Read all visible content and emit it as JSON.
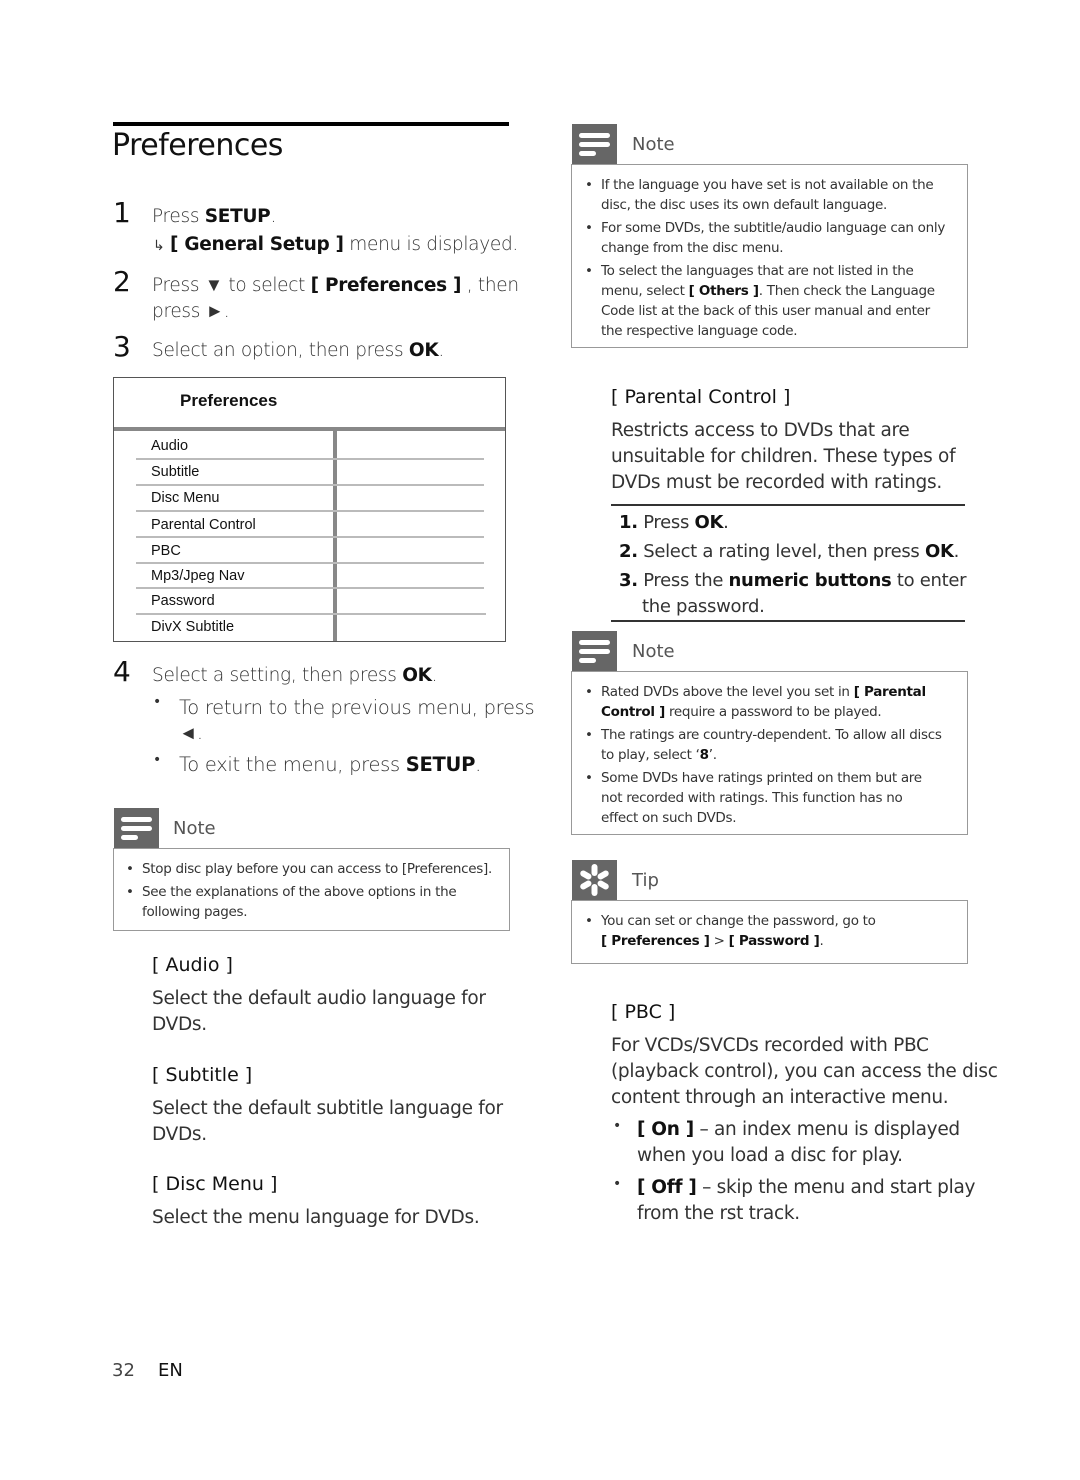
{
  "page": {
    "title": "Preferences",
    "page_number": "32",
    "language": "EN"
  },
  "steps": [
    {
      "num": "1",
      "line1_pre": "Press ",
      "line1_bold": "SETUP",
      "line1_post": ".",
      "sub_arrow": "↳",
      "sub_bold": "[ General Setup ]",
      "sub_post": " menu is displayed."
    },
    {
      "num": "2",
      "pre": "Press ▼ to select ",
      "bold": "[ Preferences ]",
      "post": " , then",
      "line2": "press ►."
    },
    {
      "num": "3",
      "pre": "Select an option, then press ",
      "bold": "OK",
      "post": "."
    },
    {
      "num": "4",
      "pre": "Select a setting, then press ",
      "bold": "OK",
      "post": "."
    }
  ],
  "step4_bullets": [
    {
      "text": "To return to the previous menu, press",
      "line2": "◄."
    },
    {
      "pre": "To exit the menu, press ",
      "bold": "SETUP",
      "post": "."
    }
  ],
  "menu": {
    "title": "Preferences",
    "items": [
      "Audio",
      "Subtitle",
      "Disc Menu",
      "Parental Control",
      "PBC",
      "Mp3/Jpeg Nav",
      "Password",
      "DivX Subtitle"
    ]
  },
  "note_left": {
    "label": "Note",
    "items": [
      "Stop disc play before you can access to [Preferences].",
      "See the explanations of the above options in the",
      "following pages."
    ]
  },
  "sections_left": [
    {
      "head": "[ Audio ]",
      "lines": [
        "Select the default audio language for",
        "DVDs."
      ]
    },
    {
      "head": "[ Subtitle ]",
      "lines": [
        "Select the default subtitle language for",
        "DVDs."
      ]
    },
    {
      "head": "[ Disc Menu ]",
      "lines": [
        "Select the menu language for DVDs."
      ]
    }
  ],
  "note_top_right": {
    "label": "Note",
    "items": [
      {
        "lines": [
          "If the language you have set is not available on the",
          "disc, the disc uses its own default language."
        ]
      },
      {
        "lines": [
          "For some DVDs, the subtitle/audio language can only",
          "change from the disc menu."
        ]
      },
      {
        "l1": "To select the languages that are not listed in the",
        "l2_pre": "menu, select ",
        "l2_bold": "[ Others ]",
        "l2_post": ". Then check the Language",
        "l3": "Code list at the back of this user manual and enter",
        "l4": "the respective language code."
      }
    ]
  },
  "parental": {
    "head": "[ Parental Control ]",
    "lines": [
      "Restricts access to DVDs that are",
      "unsuitable for children. These types of",
      "DVDs must be recorded with ratings."
    ],
    "steps": [
      {
        "num": "1.",
        "pre": "Press ",
        "bold": "OK",
        "post": "."
      },
      {
        "num": "2.",
        "pre": "Select a rating level, then press ",
        "bold": "OK",
        "post": "."
      },
      {
        "num": "3.",
        "pre": "Press the ",
        "bold": "numeric buttons",
        "post": " to enter",
        "line2": "the password."
      }
    ]
  },
  "note_mid_right": {
    "label": "Note",
    "items": [
      {
        "pre": "Rated DVDs above the level you set in ",
        "bold": "[ Parental",
        "l2_bold": "Control ]",
        "l2_post": " require a password to be played."
      },
      {
        "l1": "The ratings are country-dependent. To allow all discs",
        "l2_pre": "to play, select ‘",
        "l2_bold": "8",
        "l2_post": "’."
      },
      {
        "l1": "Some DVDs have ratings printed on them but are",
        "l2": "not recorded with ratings.  This function has no",
        "l3": "effect on such DVDs."
      }
    ]
  },
  "tip": {
    "label": "Tip",
    "l1": "You can set or change the password, go to",
    "b1": "[ Preferences ]",
    "sep": " > ",
    "b2": "[ Password ]",
    "end": "."
  },
  "pbc": {
    "head": "[ PBC ]",
    "lines": [
      "For VCDs/SVCDs recorded with PBC",
      "(playback control), you can access the disc",
      "content through an interactive menu."
    ],
    "bullets": [
      {
        "bold": "[ On ]",
        "post": " – an index menu is displayed",
        "line2": "when you load a disc for play."
      },
      {
        "bold": "[ Off ]",
        "post": " – skip the menu and start play",
        "line2": "from the   rst track."
      }
    ]
  }
}
